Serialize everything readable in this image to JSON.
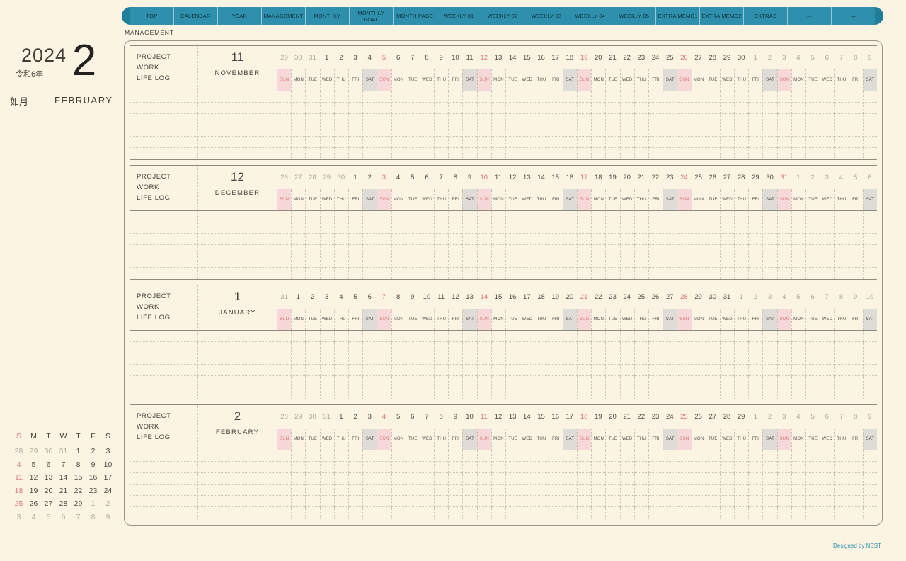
{
  "nav": {
    "tabs": [
      "TOP",
      "CALENDAR",
      "YEAR",
      "MANAGEMENT",
      "MONTHLY",
      "MONTHLY\nGOAL",
      "MONTH PAGE",
      "WEEKLY-01",
      "WEEKLY-02",
      "WEEKLY-03",
      "WEEKLY-04",
      "WEEKLY-05",
      "EXTRA MEMO1",
      "EXTRA MEMO2",
      "EXTRAS",
      "←",
      "→"
    ]
  },
  "page_label": "MANAGEMENT",
  "header": {
    "year": "2024",
    "era": "令和6年",
    "month_number": "2",
    "month_kanji": "如月",
    "month_name": "FEBRUARY"
  },
  "section_row_labels": [
    "PROJECT",
    "WORK",
    "LIFE LOG"
  ],
  "weekdays": [
    "SUN",
    "MON",
    "TUE",
    "WED",
    "THU",
    "FRI",
    "SAT"
  ],
  "months": [
    {
      "num": "11",
      "name": "NOVEMBER",
      "days": [
        [
          29,
          "o"
        ],
        [
          30,
          "o"
        ],
        [
          31,
          "o"
        ],
        [
          1,
          "i"
        ],
        [
          2,
          "i"
        ],
        [
          3,
          "i"
        ],
        [
          4,
          "i"
        ],
        [
          5,
          "r"
        ],
        [
          6,
          "i"
        ],
        [
          7,
          "i"
        ],
        [
          8,
          "i"
        ],
        [
          9,
          "i"
        ],
        [
          10,
          "i"
        ],
        [
          11,
          "i"
        ],
        [
          12,
          "r"
        ],
        [
          13,
          "i"
        ],
        [
          14,
          "i"
        ],
        [
          15,
          "i"
        ],
        [
          16,
          "i"
        ],
        [
          17,
          "i"
        ],
        [
          18,
          "i"
        ],
        [
          19,
          "r"
        ],
        [
          20,
          "i"
        ],
        [
          21,
          "i"
        ],
        [
          22,
          "i"
        ],
        [
          23,
          "i"
        ],
        [
          24,
          "i"
        ],
        [
          25,
          "i"
        ],
        [
          26,
          "r"
        ],
        [
          27,
          "i"
        ],
        [
          28,
          "i"
        ],
        [
          29,
          "i"
        ],
        [
          30,
          "i"
        ],
        [
          1,
          "o"
        ],
        [
          2,
          "o"
        ],
        [
          3,
          "o"
        ],
        [
          4,
          "o"
        ],
        [
          5,
          "o"
        ],
        [
          6,
          "o"
        ],
        [
          7,
          "o"
        ],
        [
          8,
          "o"
        ],
        [
          9,
          "o"
        ]
      ]
    },
    {
      "num": "12",
      "name": "DECEMBER",
      "days": [
        [
          26,
          "o"
        ],
        [
          27,
          "o"
        ],
        [
          28,
          "o"
        ],
        [
          29,
          "o"
        ],
        [
          30,
          "o"
        ],
        [
          1,
          "i"
        ],
        [
          2,
          "i"
        ],
        [
          3,
          "r"
        ],
        [
          4,
          "i"
        ],
        [
          5,
          "i"
        ],
        [
          6,
          "i"
        ],
        [
          7,
          "i"
        ],
        [
          8,
          "i"
        ],
        [
          9,
          "i"
        ],
        [
          10,
          "r"
        ],
        [
          11,
          "i"
        ],
        [
          12,
          "i"
        ],
        [
          13,
          "i"
        ],
        [
          14,
          "i"
        ],
        [
          15,
          "i"
        ],
        [
          16,
          "i"
        ],
        [
          17,
          "r"
        ],
        [
          18,
          "i"
        ],
        [
          19,
          "i"
        ],
        [
          20,
          "i"
        ],
        [
          21,
          "i"
        ],
        [
          22,
          "i"
        ],
        [
          23,
          "i"
        ],
        [
          24,
          "r"
        ],
        [
          25,
          "i"
        ],
        [
          26,
          "i"
        ],
        [
          27,
          "i"
        ],
        [
          28,
          "i"
        ],
        [
          29,
          "i"
        ],
        [
          30,
          "i"
        ],
        [
          31,
          "r"
        ],
        [
          1,
          "o"
        ],
        [
          2,
          "o"
        ],
        [
          3,
          "o"
        ],
        [
          4,
          "o"
        ],
        [
          5,
          "o"
        ],
        [
          6,
          "o"
        ]
      ]
    },
    {
      "num": "1",
      "name": "JANUARY",
      "days": [
        [
          31,
          "o"
        ],
        [
          1,
          "i"
        ],
        [
          2,
          "i"
        ],
        [
          3,
          "i"
        ],
        [
          4,
          "i"
        ],
        [
          5,
          "i"
        ],
        [
          6,
          "i"
        ],
        [
          7,
          "r"
        ],
        [
          8,
          "i"
        ],
        [
          9,
          "i"
        ],
        [
          10,
          "i"
        ],
        [
          11,
          "i"
        ],
        [
          12,
          "i"
        ],
        [
          13,
          "i"
        ],
        [
          14,
          "r"
        ],
        [
          15,
          "i"
        ],
        [
          16,
          "i"
        ],
        [
          17,
          "i"
        ],
        [
          18,
          "i"
        ],
        [
          19,
          "i"
        ],
        [
          20,
          "i"
        ],
        [
          21,
          "r"
        ],
        [
          22,
          "i"
        ],
        [
          23,
          "i"
        ],
        [
          24,
          "i"
        ],
        [
          25,
          "i"
        ],
        [
          26,
          "i"
        ],
        [
          27,
          "i"
        ],
        [
          28,
          "r"
        ],
        [
          29,
          "i"
        ],
        [
          30,
          "i"
        ],
        [
          31,
          "i"
        ],
        [
          1,
          "o"
        ],
        [
          2,
          "o"
        ],
        [
          3,
          "o"
        ],
        [
          4,
          "o"
        ],
        [
          5,
          "o"
        ],
        [
          6,
          "o"
        ],
        [
          7,
          "o"
        ],
        [
          8,
          "o"
        ],
        [
          9,
          "o"
        ],
        [
          10,
          "o"
        ]
      ]
    },
    {
      "num": "2",
      "name": "FEBRUARY",
      "days": [
        [
          28,
          "o"
        ],
        [
          29,
          "o"
        ],
        [
          30,
          "o"
        ],
        [
          31,
          "o"
        ],
        [
          1,
          "i"
        ],
        [
          2,
          "i"
        ],
        [
          3,
          "i"
        ],
        [
          4,
          "r"
        ],
        [
          5,
          "i"
        ],
        [
          6,
          "i"
        ],
        [
          7,
          "i"
        ],
        [
          8,
          "i"
        ],
        [
          9,
          "i"
        ],
        [
          10,
          "i"
        ],
        [
          11,
          "r"
        ],
        [
          12,
          "i"
        ],
        [
          13,
          "i"
        ],
        [
          14,
          "i"
        ],
        [
          15,
          "i"
        ],
        [
          16,
          "i"
        ],
        [
          17,
          "i"
        ],
        [
          18,
          "r"
        ],
        [
          19,
          "i"
        ],
        [
          20,
          "i"
        ],
        [
          21,
          "i"
        ],
        [
          22,
          "i"
        ],
        [
          23,
          "i"
        ],
        [
          24,
          "i"
        ],
        [
          25,
          "r"
        ],
        [
          26,
          "i"
        ],
        [
          27,
          "i"
        ],
        [
          28,
          "i"
        ],
        [
          29,
          "i"
        ],
        [
          1,
          "o"
        ],
        [
          2,
          "o"
        ],
        [
          3,
          "o"
        ],
        [
          4,
          "o"
        ],
        [
          5,
          "o"
        ],
        [
          6,
          "o"
        ],
        [
          7,
          "o"
        ],
        [
          8,
          "o"
        ],
        [
          9,
          "o"
        ]
      ]
    }
  ],
  "mini_calendar": {
    "day_headers": [
      "S",
      "M",
      "T",
      "W",
      "T",
      "F",
      "S"
    ],
    "rows": [
      [
        [
          28,
          "o"
        ],
        [
          29,
          "o"
        ],
        [
          30,
          "o"
        ],
        [
          31,
          "o"
        ],
        [
          1,
          "i"
        ],
        [
          2,
          "i"
        ],
        [
          3,
          "i"
        ]
      ],
      [
        [
          4,
          "r"
        ],
        [
          5,
          "i"
        ],
        [
          6,
          "i"
        ],
        [
          7,
          "i"
        ],
        [
          8,
          "i"
        ],
        [
          9,
          "i"
        ],
        [
          10,
          "i"
        ]
      ],
      [
        [
          11,
          "r"
        ],
        [
          12,
          "i"
        ],
        [
          13,
          "i"
        ],
        [
          14,
          "i"
        ],
        [
          15,
          "i"
        ],
        [
          16,
          "i"
        ],
        [
          17,
          "i"
        ]
      ],
      [
        [
          18,
          "r"
        ],
        [
          19,
          "i"
        ],
        [
          20,
          "i"
        ],
        [
          21,
          "i"
        ],
        [
          22,
          "i"
        ],
        [
          23,
          "i"
        ],
        [
          24,
          "i"
        ]
      ],
      [
        [
          25,
          "r"
        ],
        [
          26,
          "i"
        ],
        [
          27,
          "i"
        ],
        [
          28,
          "i"
        ],
        [
          29,
          "i"
        ],
        [
          1,
          "o"
        ],
        [
          2,
          "o"
        ]
      ],
      [
        [
          3,
          "o"
        ],
        [
          4,
          "o"
        ],
        [
          5,
          "o"
        ],
        [
          6,
          "o"
        ],
        [
          7,
          "o"
        ],
        [
          8,
          "o"
        ],
        [
          9,
          "o"
        ]
      ]
    ]
  },
  "footer": {
    "credit": "Designed by NEST"
  },
  "colors": {
    "accent_teal": "#2e90ac",
    "sunday_red": "#dd7277",
    "sunday_bg": "#f6d8d8",
    "saturday_bg": "#dddcd6",
    "background": "#fbf4e3",
    "out_of_month_gray": "#ada695"
  }
}
